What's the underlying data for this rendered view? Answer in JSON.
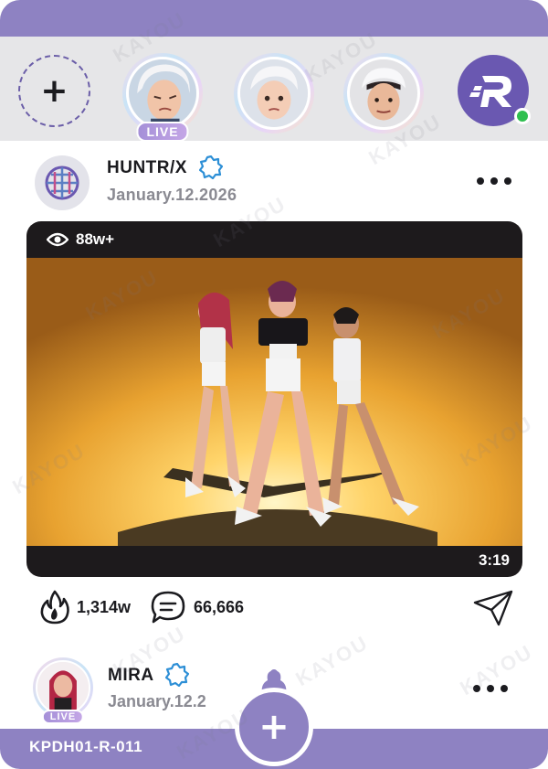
{
  "colors": {
    "brand_purple": "#8e82c2",
    "brand_dark_purple": "#6a58b1",
    "verified_blue": "#2d8fd6",
    "online_green": "#2fbf4f"
  },
  "stories": {
    "add_icon": "plus-icon",
    "items": [
      {
        "name": "story-1",
        "live_label": "LIVE"
      },
      {
        "name": "story-2"
      },
      {
        "name": "story-3"
      }
    ],
    "brand_icon": "r-logo-icon"
  },
  "post": {
    "username": "HUNTR/X",
    "date": "January.12.2026",
    "views": "88w+",
    "duration": "3:19",
    "likes": "1,314w",
    "comments": "66,666",
    "icons": {
      "views": "eye-icon",
      "likes": "flame-icon",
      "comments": "comment-icon",
      "share": "send-icon",
      "more": "more-icon",
      "verified": "verified-badge-icon"
    }
  },
  "next_post": {
    "username": "MIRA",
    "date": "January.12.2",
    "live_label": "LIVE"
  },
  "footer": {
    "card_code": "KPDH01-R-011",
    "fab_icon": "plus-icon"
  },
  "watermark": "KAYOU"
}
